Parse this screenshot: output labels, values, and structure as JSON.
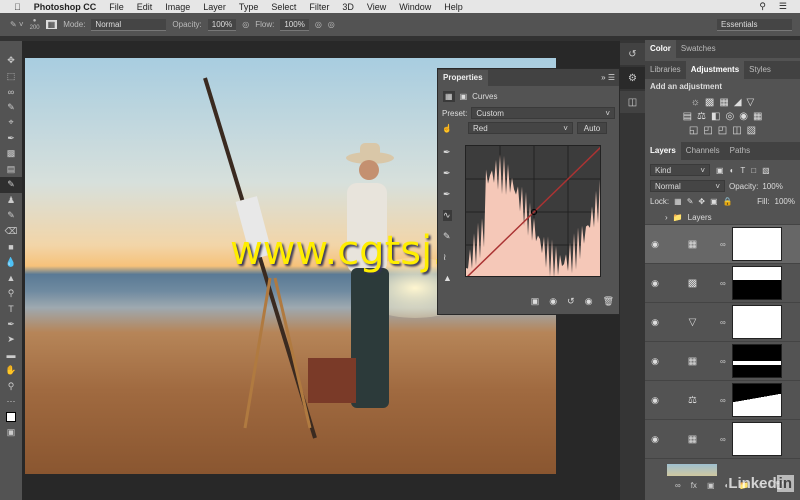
{
  "menubar": {
    "app": "Photoshop CC",
    "items": [
      "File",
      "Edit",
      "Image",
      "Layer",
      "Type",
      "Select",
      "Filter",
      "3D",
      "View",
      "Window",
      "Help"
    ]
  },
  "options": {
    "brush_size": "200",
    "mode_label": "Mode:",
    "mode": "Normal",
    "opacity_label": "Opacity:",
    "opacity": "100%",
    "flow_label": "Flow:",
    "flow": "100%",
    "workspace": "Essentials"
  },
  "properties": {
    "title": "Properties",
    "type": "Curves",
    "preset_label": "Preset:",
    "preset": "Custom",
    "channel": "Red",
    "auto": "Auto"
  },
  "color_panel": {
    "tabs": [
      "Color",
      "Swatches"
    ]
  },
  "adjustments": {
    "tabs": [
      "Libraries",
      "Adjustments",
      "Styles"
    ],
    "heading": "Add an adjustment"
  },
  "layers": {
    "tabs": [
      "Layers",
      "Channels",
      "Paths"
    ],
    "kind": "Kind",
    "blend": "Normal",
    "opacity_label": "Opacity:",
    "opacity": "100%",
    "lock_label": "Lock:",
    "fill_label": "Fill:",
    "fill": "100%",
    "group": "Layers",
    "items": [
      {
        "icon": "curves",
        "mask": "white",
        "selected": true
      },
      {
        "icon": "levels",
        "mask": "top-white"
      },
      {
        "icon": "triangle-invert",
        "mask": "white"
      },
      {
        "icon": "curves",
        "mask": "black-stripe"
      },
      {
        "icon": "color-balance",
        "mask": "bottom-white"
      },
      {
        "icon": "curves",
        "mask": "white"
      }
    ]
  },
  "watermark": "www.cgtsj.com",
  "logo": "LinkedIn",
  "colors": {
    "curve_line": "#a33",
    "histogram": "#f5c8b8"
  }
}
